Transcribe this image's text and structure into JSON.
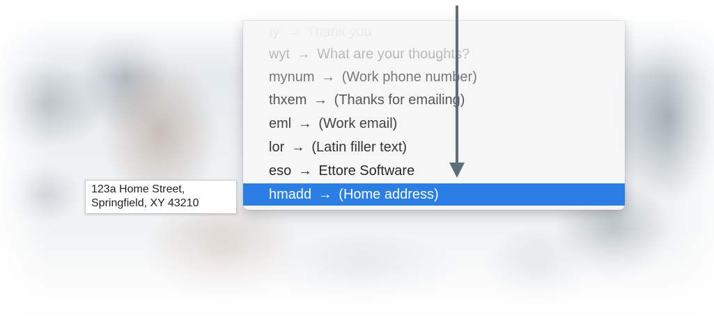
{
  "menu": {
    "items": [
      {
        "abbr": "ty",
        "arrow": "→",
        "expansion": "Thank you",
        "opacity": 0.25
      },
      {
        "abbr": "wyt",
        "arrow": "→",
        "expansion": "What are your thoughts?",
        "opacity": 0.45
      },
      {
        "abbr": "mynum",
        "arrow": "→",
        "expansion": "(Work phone number)",
        "opacity": 0.62
      },
      {
        "abbr": "thxem",
        "arrow": "→",
        "expansion": "(Thanks for emailing)",
        "opacity": 0.78
      },
      {
        "abbr": "eml",
        "arrow": "→",
        "expansion": "(Work email)",
        "opacity": 0.88
      },
      {
        "abbr": "lor",
        "arrow": "→",
        "expansion": "(Latin filler text)",
        "opacity": 0.95
      },
      {
        "abbr": "eso",
        "arrow": "→",
        "expansion": "Ettore Software",
        "opacity": 1
      },
      {
        "abbr": "hmadd",
        "arrow": "→",
        "expansion": "(Home address)",
        "opacity": 1,
        "selected": true
      }
    ],
    "selected_color": "#2a7ee6"
  },
  "tooltip": {
    "line1": "123a Home Street,",
    "line2": "Springfield, XY 43210"
  },
  "annotation": {
    "arrow_color": "#5d6e78",
    "icon": "down-arrow-icon"
  }
}
